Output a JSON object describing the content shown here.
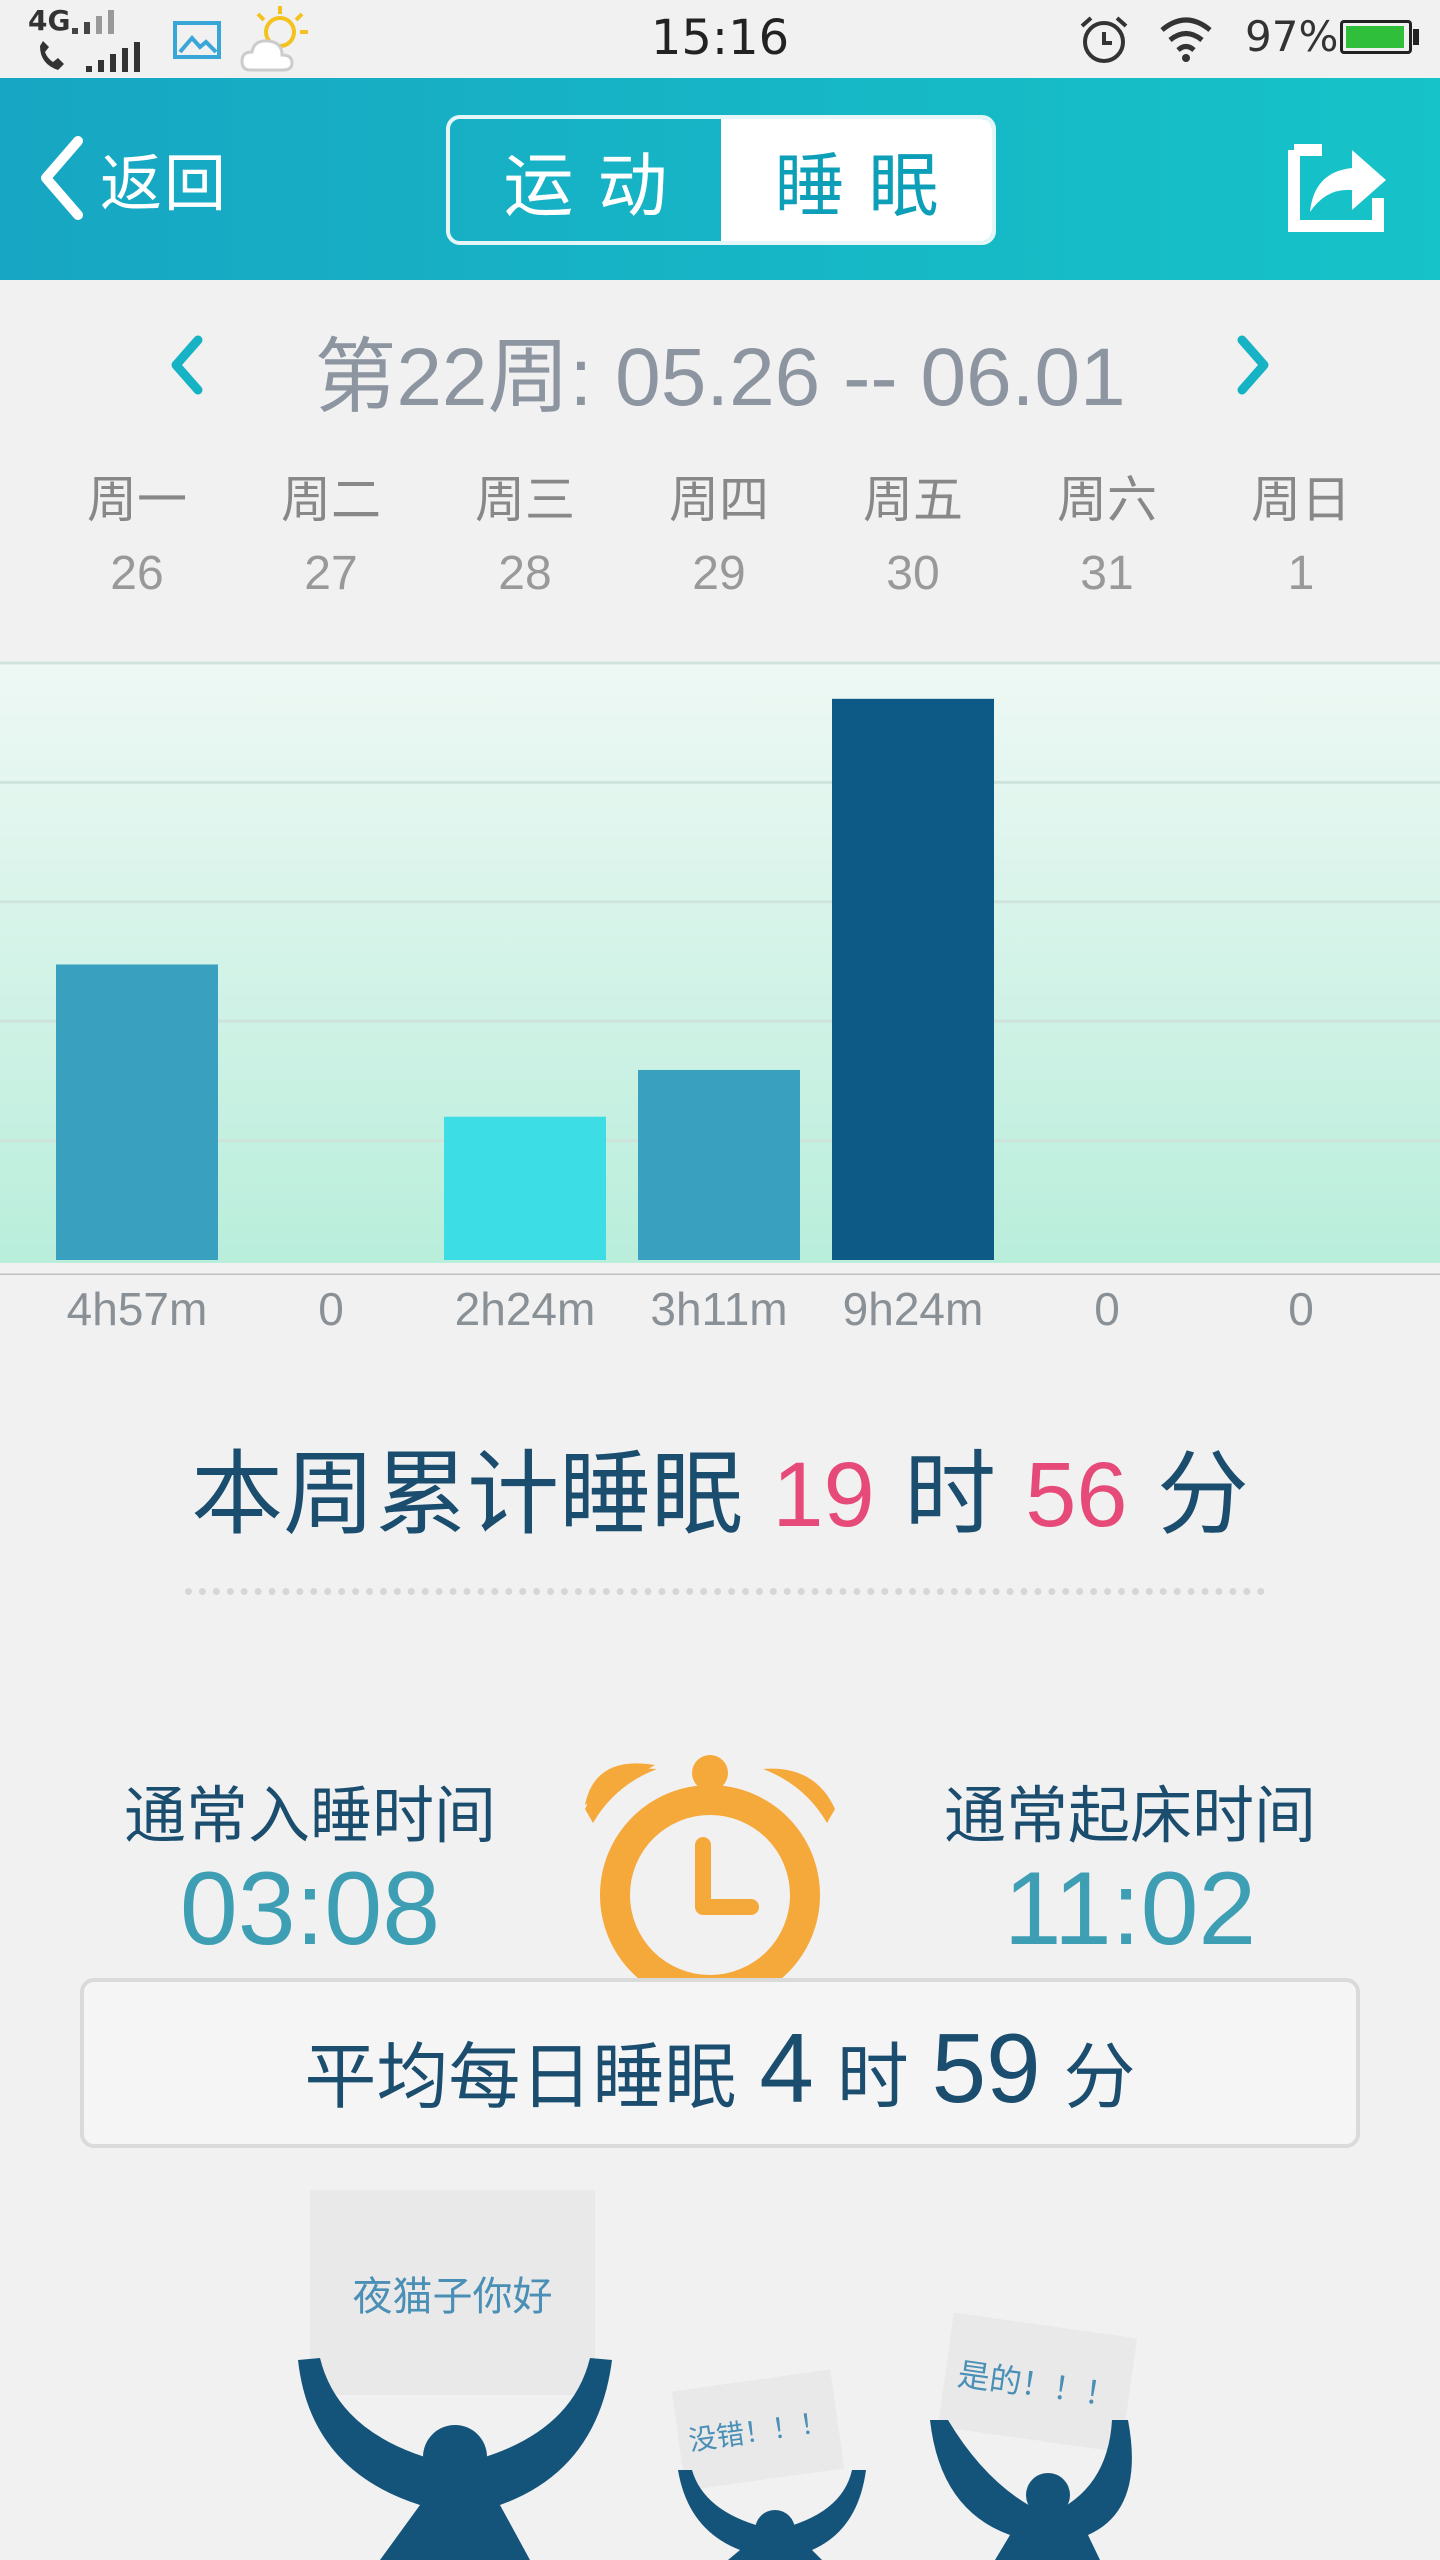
{
  "status_bar": {
    "network": "4G",
    "time": "15:16",
    "battery_percent": "97%",
    "battery_level": 0.97,
    "icons": [
      "signal-icon",
      "phone-signal-icon",
      "gallery-icon",
      "weather-icon",
      "alarm-icon",
      "wifi-icon",
      "battery-icon"
    ]
  },
  "header": {
    "back_label": "返回",
    "tabs": [
      {
        "label": "运动",
        "active": false
      },
      {
        "label": "睡眠",
        "active": true
      }
    ],
    "share_icon": "share-icon"
  },
  "week": {
    "title": "第22周:  05.26 -- 06.01",
    "days": [
      {
        "name": "周一",
        "date": "26"
      },
      {
        "name": "周二",
        "date": "27"
      },
      {
        "name": "周三",
        "date": "28"
      },
      {
        "name": "周四",
        "date": "29"
      },
      {
        "name": "周五",
        "date": "30"
      },
      {
        "name": "周六",
        "date": "31"
      },
      {
        "name": "周日",
        "date": "1"
      }
    ]
  },
  "chart_data": {
    "type": "bar",
    "categories": [
      "周一",
      "周二",
      "周三",
      "周四",
      "周五",
      "周六",
      "周日"
    ],
    "values_minutes": [
      297,
      0,
      144,
      191,
      564,
      0,
      0
    ],
    "value_labels": [
      "4h57m",
      "0",
      "2h24m",
      "3h11m",
      "9h24m",
      "0",
      "0"
    ],
    "bar_colors": [
      "#3aa0c0",
      "#3aa0c0",
      "#3ddde6",
      "#3aa0c0",
      "#0d5a86",
      "#3aa0c0",
      "#3aa0c0"
    ],
    "ylim_minutes": [
      0,
      600
    ],
    "grid": true,
    "title": "",
    "xlabel": "",
    "ylabel": ""
  },
  "summary": {
    "total_prefix": "本周累计睡眠",
    "total_hours": "19",
    "total_hours_unit": "时",
    "total_minutes": "56",
    "total_minutes_unit": "分",
    "usual_sleep_label": "通常入睡时间",
    "usual_sleep_value": "03:08",
    "usual_wake_label": "通常起床时间",
    "usual_wake_value": "11:02",
    "avg_prefix": "平均每日睡眠",
    "avg_hours": "4",
    "avg_hours_unit": "时",
    "avg_minutes": "59",
    "avg_minutes_unit": "分"
  },
  "illustration": {
    "sign_1": "夜猫子你好",
    "sign_2": "没错！！！",
    "sign_3": "是的！！！"
  },
  "colors": {
    "header_start": "#17a6c3",
    "header_end": "#16c3c8",
    "accent": "#1b4d6e",
    "highlight": "#e64a78",
    "clock": "#f5a93b"
  }
}
